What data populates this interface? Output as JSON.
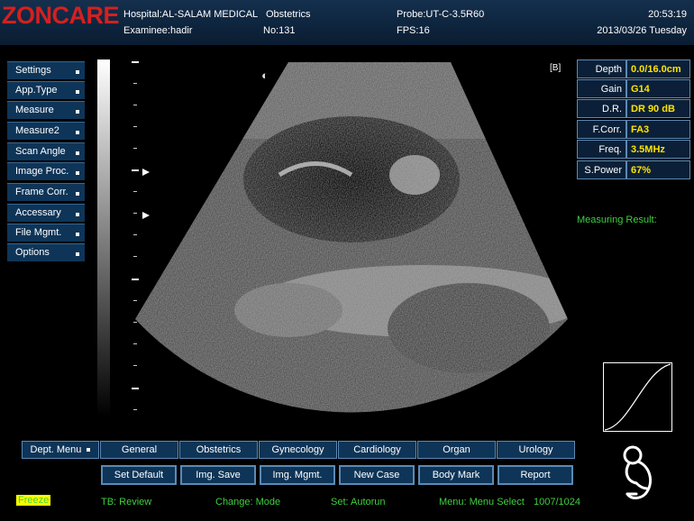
{
  "header": {
    "logo": "ZONCARE",
    "hospital": "Hospital:AL-SALAM MEDICAL",
    "exam_type": "Obstetrics",
    "examinee": "Examinee:hadir",
    "number": "No:131",
    "probe": "Probe:UT-C-3.5R60",
    "fps": "FPS:16",
    "time": "20:53:19",
    "date": "2013/03/26 Tuesday"
  },
  "menu": {
    "items": [
      "Settings",
      "App.Type",
      "Measure",
      "Measure2",
      "Scan Angle",
      "Image Proc.",
      "Frame Corr.",
      "Accessary",
      "File Mgmt.",
      "Options"
    ]
  },
  "image": {
    "mode_label": "[B]"
  },
  "params": [
    {
      "label": "Depth",
      "value": "0.0/16.0cm"
    },
    {
      "label": "Gain",
      "value": "G14"
    },
    {
      "label": "D.R.",
      "value": "DR 90 dB"
    },
    {
      "label": "F.Corr.",
      "value": "FA3"
    },
    {
      "label": "Freq.",
      "value": "3.5MHz"
    },
    {
      "label": "S.Power",
      "value": "67%"
    }
  ],
  "measuring_result": "Measuring Result:",
  "dept_tabs": [
    "Dept. Menu",
    "General",
    "Obstetrics",
    "Gynecology",
    "Cardiology",
    "Organ",
    "Urology"
  ],
  "buttons": [
    "Set Default",
    "Img. Save",
    "Img. Mgmt.",
    "New Case",
    "Body Mark",
    "Report"
  ],
  "status": {
    "freeze": "Freeze",
    "tb": "TB: Review",
    "change": "Change: Mode",
    "set": "Set: Autorun",
    "menu": "Menu: Menu Select",
    "frames": "1007/1024"
  },
  "colors": {
    "header_bg": "#0f2640",
    "menu_bg": "#0e3558",
    "param_value": "#ffe300",
    "status_text": "#3fcf3f",
    "freeze_bg": "#ffff00",
    "logo": "#d42020"
  }
}
